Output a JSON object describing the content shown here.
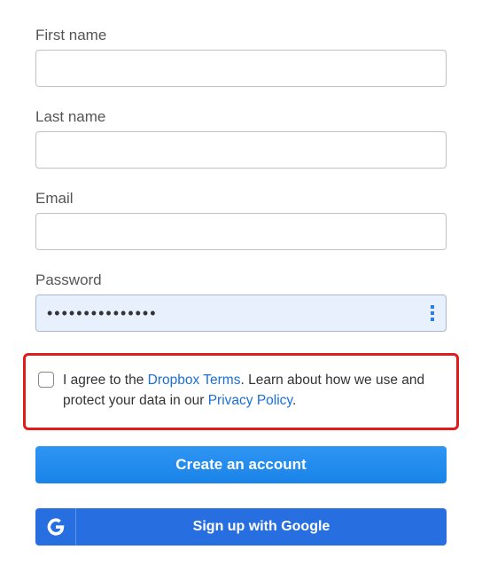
{
  "form": {
    "first_name_label": "First name",
    "first_name_value": "",
    "last_name_label": "Last name",
    "last_name_value": "",
    "email_label": "Email",
    "email_value": "",
    "password_label": "Password",
    "password_value": "•••••••••••••••"
  },
  "terms": {
    "text_before_terms_link": "I agree to the ",
    "terms_link": "Dropbox Terms",
    "text_after_terms": ". Learn about how we use and protect your data in our ",
    "privacy_link": "Privacy Policy",
    "text_end": "."
  },
  "buttons": {
    "create_account": "Create an account",
    "google_signup": "Sign up with Google"
  },
  "colors": {
    "highlight_border": "#e21b1b",
    "primary_blue": "#1a83e8",
    "google_blue": "#276fe0",
    "link_blue": "#1a6fd6"
  }
}
